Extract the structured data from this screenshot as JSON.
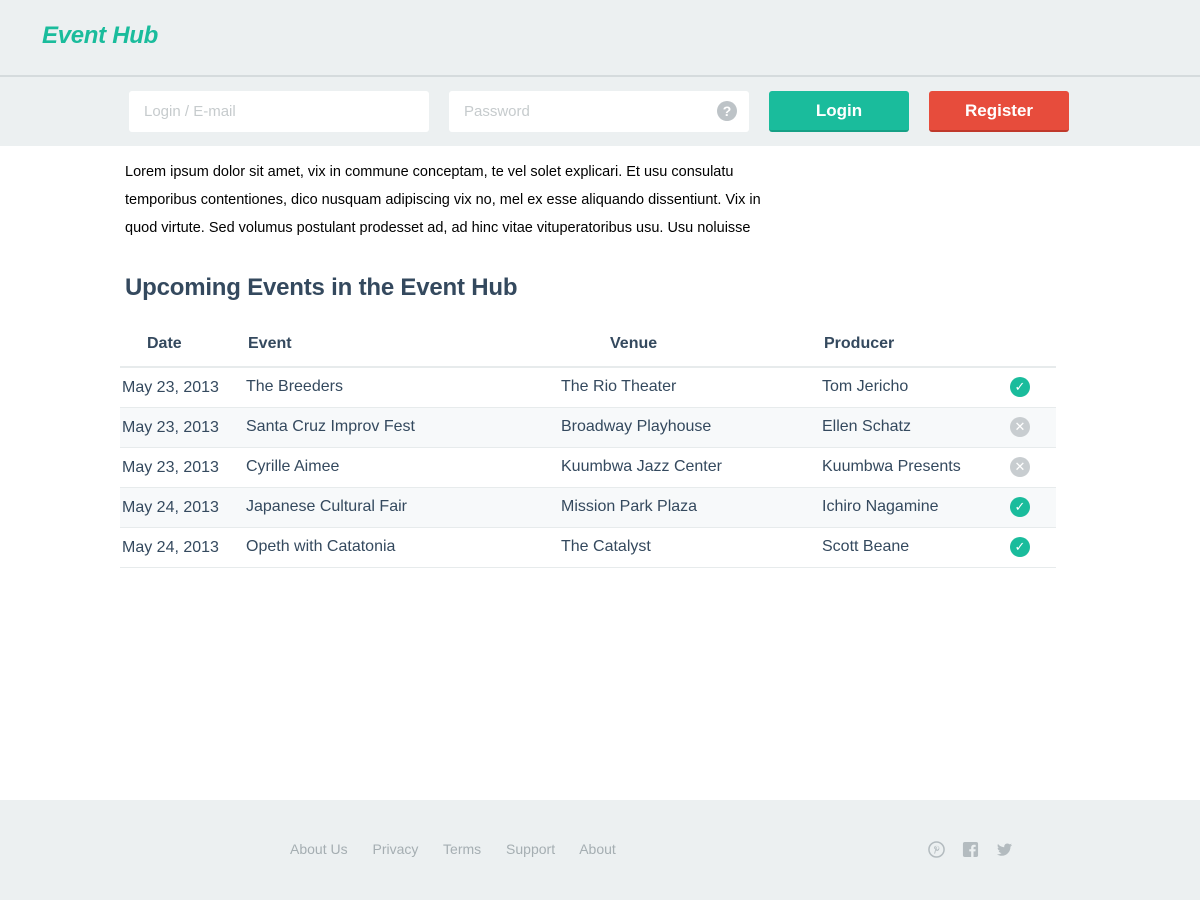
{
  "header": {
    "brand": "Event Hub"
  },
  "login_bar": {
    "login_placeholder": "Login / E-mail",
    "password_placeholder": "Password",
    "help_glyph": "?",
    "login_button": "Login",
    "register_button": "Register"
  },
  "intro": {
    "text": "Lorem ipsum dolor sit amet, vix in commune conceptam, te vel solet explicari. Et usu consulatu temporibus contentiones, dico nusquam adipiscing vix no, mel ex esse aliquando dissentiunt. Vix in quod virtute. Sed volumus postulant prodesset ad, ad hinc vitae vituperatoribus usu. Usu noluisse"
  },
  "events": {
    "title": "Upcoming Events in the Event Hub",
    "columns": {
      "date": "Date",
      "event": "Event",
      "venue": "Venue",
      "producer": "Producer"
    },
    "rows": [
      {
        "date": "May 23, 2013",
        "event": "The Breeders",
        "venue": "The Rio Theater",
        "producer": "Tom Jericho",
        "status": "confirmed"
      },
      {
        "date": "May 23, 2013",
        "event": "Santa Cruz Improv Fest",
        "venue": "Broadway Playhouse",
        "producer": "Ellen Schatz",
        "status": "cancelled"
      },
      {
        "date": "May 23, 2013",
        "event": "Cyrille Aimee",
        "venue": "Kuumbwa Jazz Center",
        "producer": "Kuumbwa Presents",
        "status": "cancelled"
      },
      {
        "date": "May 24, 2013",
        "event": "Japanese Cultural Fair",
        "venue": "Mission Park Plaza",
        "producer": "Ichiro Nagamine",
        "status": "confirmed"
      },
      {
        "date": "May 24, 2013",
        "event": "Opeth with Catatonia",
        "venue": "The Catalyst",
        "producer": "Scott Beane",
        "status": "confirmed"
      }
    ]
  },
  "footer": {
    "links": [
      "About Us",
      "Privacy",
      "Terms",
      "Support",
      "About"
    ],
    "social_icons": [
      "pinterest-icon",
      "facebook-icon",
      "twitter-icon"
    ]
  },
  "colors": {
    "accent": "#1abc9c",
    "danger": "#e74c3c",
    "header_bg": "#ecf0f1",
    "status_inactive": "#c8cdd0"
  }
}
